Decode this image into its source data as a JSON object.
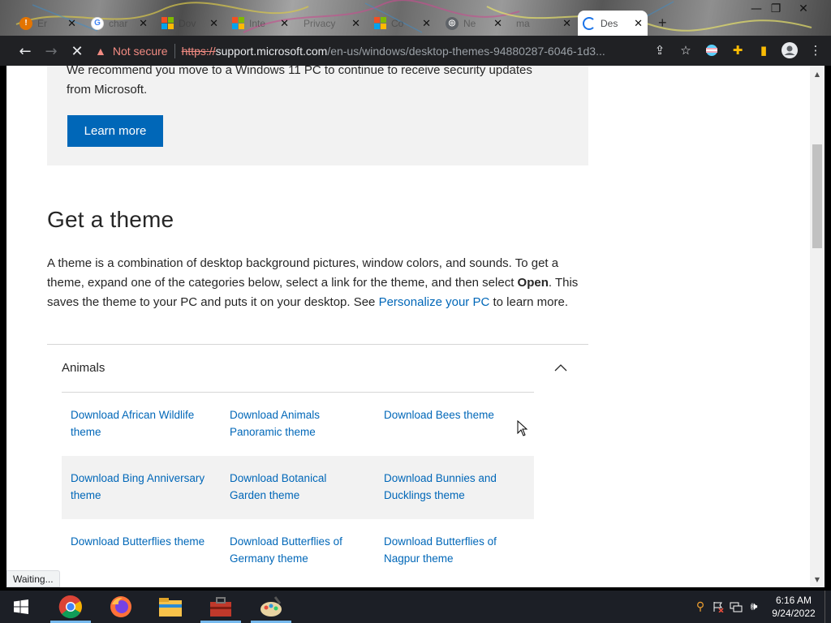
{
  "browser": {
    "tabs": [
      {
        "title": "Er",
        "icon": "chrome-error-icon",
        "active": false
      },
      {
        "title": "char",
        "icon": "google-icon",
        "active": false
      },
      {
        "title": "Dov",
        "icon": "microsoft-icon",
        "active": false
      },
      {
        "title": "Inte",
        "icon": "microsoft-icon",
        "active": false
      },
      {
        "title": "Privacy",
        "icon": "none",
        "active": false
      },
      {
        "title": "Co",
        "icon": "microsoft-icon",
        "active": false
      },
      {
        "title": "Ne",
        "icon": "chrome-icon",
        "active": false
      },
      {
        "title": "ma",
        "icon": "none",
        "active": false
      },
      {
        "title": "Des",
        "icon": "loading-icon",
        "active": true
      }
    ],
    "security_label": "Not secure",
    "url_scheme": "https://",
    "url_host": "support.microsoft.com",
    "url_path": "/en-us/windows/desktop-themes-94880287-6046-1d3..."
  },
  "page": {
    "notice_text": "We recommend you move to a Windows 11 PC to continue to receive security updates from Microsoft.",
    "learn_more_label": "Learn more",
    "section_title": "Get a theme",
    "intro_part1": "A theme is a combination of desktop background pictures, window colors, and sounds. To get a theme, expand one of the categories below, select a link for the theme, and then select ",
    "intro_bold": "Open",
    "intro_part2": ". This saves the theme to your PC and puts it on your desktop. See ",
    "intro_link": "Personalize your PC",
    "intro_part3": " to learn more.",
    "accordion_title": "Animals",
    "theme_links": [
      [
        "Download African Wildlife theme",
        "Download Animals Panoramic theme",
        "Download Bees theme"
      ],
      [
        "Download Bing Anniversary theme",
        "Download Botanical Garden theme",
        "Download Bunnies and Ducklings theme"
      ],
      [
        "Download Butterflies theme",
        "Download Butterflies of Germany theme",
        "Download Butterflies of Nagpur theme"
      ]
    ]
  },
  "status_text": "Waiting...",
  "taskbar": {
    "apps": [
      "chrome-icon",
      "firefox-icon",
      "file-explorer-icon",
      "toolbox-icon",
      "paint-icon"
    ],
    "time": "6:16 AM",
    "date": "9/24/2022"
  },
  "colors": {
    "link": "#0067b8",
    "button_bg": "#0067b8",
    "toolbar_bg": "#202124",
    "taskbar_bg": "#1c1f26"
  }
}
